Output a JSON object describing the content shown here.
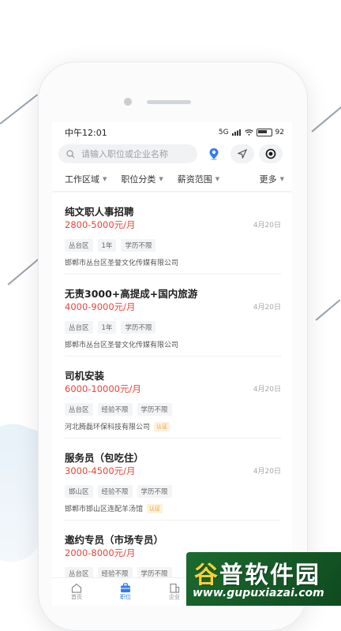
{
  "status_bar": {
    "time": "中午12:01",
    "signal": "5G",
    "battery": "92"
  },
  "search": {
    "placeholder": "请输入职位或企业名称"
  },
  "filters": [
    {
      "label": "工作区域"
    },
    {
      "label": "职位分类"
    },
    {
      "label": "薪资范围"
    },
    {
      "label": "更多"
    }
  ],
  "jobs": [
    {
      "title": "纯文职人事招聘",
      "salary": "2800-5000元/月",
      "date": "4月20日",
      "tags": [
        "丛台区",
        "1年",
        "学历不限"
      ],
      "company": "邯郸市丛台区圣誉文化传媒有限公司",
      "verified": ""
    },
    {
      "title": "无责3000+高提成+国内旅游",
      "salary": "4000-9000元/月",
      "date": "4月20日",
      "tags": [
        "丛台区",
        "1年",
        "学历不限"
      ],
      "company": "邯郸市丛台区圣誉文化传媒有限公司",
      "verified": ""
    },
    {
      "title": "司机安装",
      "salary": "6000-10000元/月",
      "date": "4月20日",
      "tags": [
        "丛台区",
        "经验不限",
        "学历不限"
      ],
      "company": "河北腾磊环保科技有限公司",
      "verified": "认证"
    },
    {
      "title": "服务员（包吃住）",
      "salary": "3000-4500元/月",
      "date": "4月20日",
      "tags": [
        "邯山区",
        "经验不限",
        "学历不限"
      ],
      "company": "邯郸市邯山区连配羊汤馆",
      "verified": "认证"
    },
    {
      "title": "邀约专员（市场专员）",
      "salary": "2000-8000元/月",
      "date": "",
      "tags": [
        "丛台区",
        "经验不限",
        "学历不限"
      ],
      "company": "",
      "verified": ""
    }
  ],
  "tabbar": [
    {
      "label": "首页"
    },
    {
      "label": "职位"
    },
    {
      "label": "企业"
    }
  ],
  "watermark": {
    "title_a": "谷",
    "title_b": "普软件园",
    "url": "www.gupuxiazai.com"
  },
  "colors": {
    "accent": "#2f7cf6",
    "salary": "#e2483d",
    "verified": "#e8a33b",
    "watermark_bg": "#1c6b2f"
  }
}
